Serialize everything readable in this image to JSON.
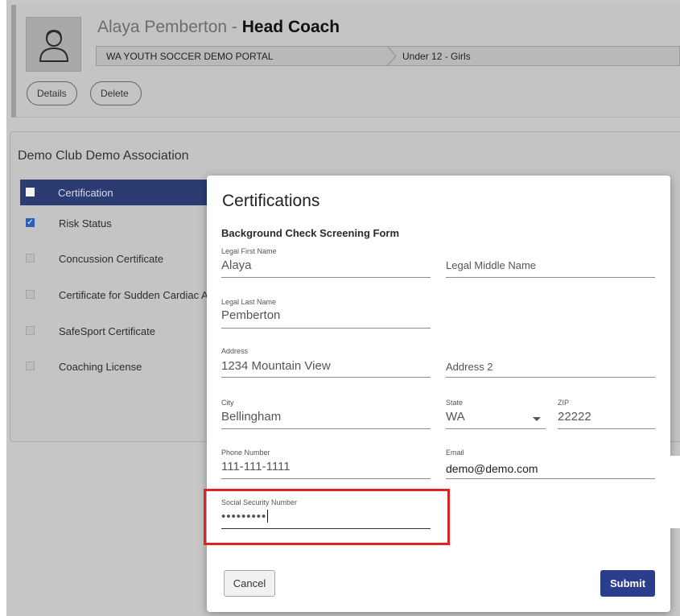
{
  "coach": {
    "name": "Alaya Pemberton",
    "separator": " - ",
    "role": "Head Coach",
    "avatar_icon": "user-avatar-icon"
  },
  "breadcrumb": {
    "items": [
      "WA YOUTH SOCCER DEMO PORTAL",
      "Under 12 - Girls"
    ]
  },
  "actions": {
    "details": "Details",
    "delete": "Delete"
  },
  "club": {
    "title": "Demo Club Demo Association",
    "table_header": "Certification",
    "certifications": [
      {
        "label": "Risk Status",
        "checked": true
      },
      {
        "label": "Concussion Certificate",
        "checked": false
      },
      {
        "label": "Certificate for Sudden Cardiac Arrest",
        "checked": false
      },
      {
        "label": "SafeSport Certificate",
        "checked": false
      },
      {
        "label": "Coaching License",
        "checked": false
      }
    ]
  },
  "modal": {
    "title": "Certifications",
    "subtitle": "Background Check Screening Form",
    "fields": {
      "first_name": {
        "label": "Legal First Name",
        "value": "Alaya"
      },
      "middle_name": {
        "placeholder": "Legal Middle Name"
      },
      "last_name": {
        "label": "Legal Last Name",
        "value": "Pemberton"
      },
      "address": {
        "label": "Address",
        "value": "1234 Mountain View"
      },
      "address2": {
        "placeholder": "Address 2"
      },
      "city": {
        "label": "City",
        "value": "Bellingham"
      },
      "state": {
        "label": "State",
        "value": "WA"
      },
      "zip": {
        "label": "ZIP",
        "value": "22222"
      },
      "phone": {
        "label": "Phone Number",
        "value": "111-111-1111"
      },
      "email": {
        "label": "Email",
        "value": "demo@demo.com"
      },
      "ssn": {
        "label": "Social Security Number",
        "value": "•••••••••"
      }
    },
    "cancel_label": "Cancel",
    "submit_label": "Submit"
  },
  "colors": {
    "accent": "#2b3e8c",
    "table_header": "#2b3c72",
    "highlight": "#e32121",
    "overlay": "#c7c7c7"
  }
}
